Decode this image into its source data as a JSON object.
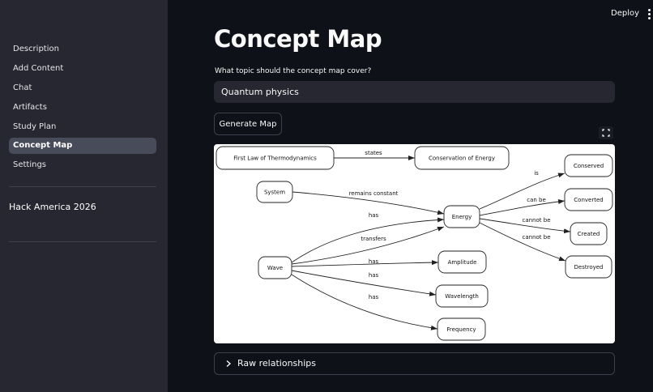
{
  "sidebar": {
    "items": [
      {
        "label": "Description",
        "active": false
      },
      {
        "label": "Add Content",
        "active": false
      },
      {
        "label": "Chat",
        "active": false
      },
      {
        "label": "Artifacts",
        "active": false
      },
      {
        "label": "Study Plan",
        "active": false
      },
      {
        "label": "Concept Map",
        "active": true
      },
      {
        "label": "Settings",
        "active": false
      }
    ],
    "project_title": "Hack America 2026"
  },
  "topbar": {
    "deploy_label": "Deploy",
    "menu_icon": "vertical-dots-icon"
  },
  "main": {
    "title": "Concept Map",
    "topic_label": "What topic should the concept map cover?",
    "topic_value": "Quantum physics",
    "generate_label": "Generate Map",
    "fullscreen_icon": "fullscreen-icon",
    "expander_label": "Raw relationships",
    "expander_icon": "chevron-right-icon"
  },
  "concept_map": {
    "nodes": [
      {
        "id": "first_law",
        "label": "First Law of Thermodynamics"
      },
      {
        "id": "conservation",
        "label": "Conservation of Energy"
      },
      {
        "id": "system",
        "label": "System"
      },
      {
        "id": "energy",
        "label": "Energy"
      },
      {
        "id": "wave",
        "label": "Wave"
      },
      {
        "id": "conserved",
        "label": "Conserved"
      },
      {
        "id": "converted",
        "label": "Converted"
      },
      {
        "id": "created",
        "label": "Created"
      },
      {
        "id": "destroyed",
        "label": "Destroyed"
      },
      {
        "id": "amplitude",
        "label": "Amplitude"
      },
      {
        "id": "wavelength",
        "label": "Wavelength"
      },
      {
        "id": "frequency",
        "label": "Frequency"
      }
    ],
    "edges": [
      {
        "from": "first_law",
        "to": "conservation",
        "label": "states"
      },
      {
        "from": "system",
        "to": "energy",
        "label": "remains constant"
      },
      {
        "from": "wave",
        "to": "energy",
        "label": "has"
      },
      {
        "from": "wave",
        "to": "energy",
        "label": "transfers"
      },
      {
        "from": "wave",
        "to": "amplitude",
        "label": "has"
      },
      {
        "from": "wave",
        "to": "wavelength",
        "label": "has"
      },
      {
        "from": "wave",
        "to": "frequency",
        "label": "has"
      },
      {
        "from": "energy",
        "to": "conserved",
        "label": "is"
      },
      {
        "from": "energy",
        "to": "converted",
        "label": "can be"
      },
      {
        "from": "energy",
        "to": "created",
        "label": "cannot be"
      },
      {
        "from": "energy",
        "to": "destroyed",
        "label": "cannot be"
      }
    ]
  }
}
